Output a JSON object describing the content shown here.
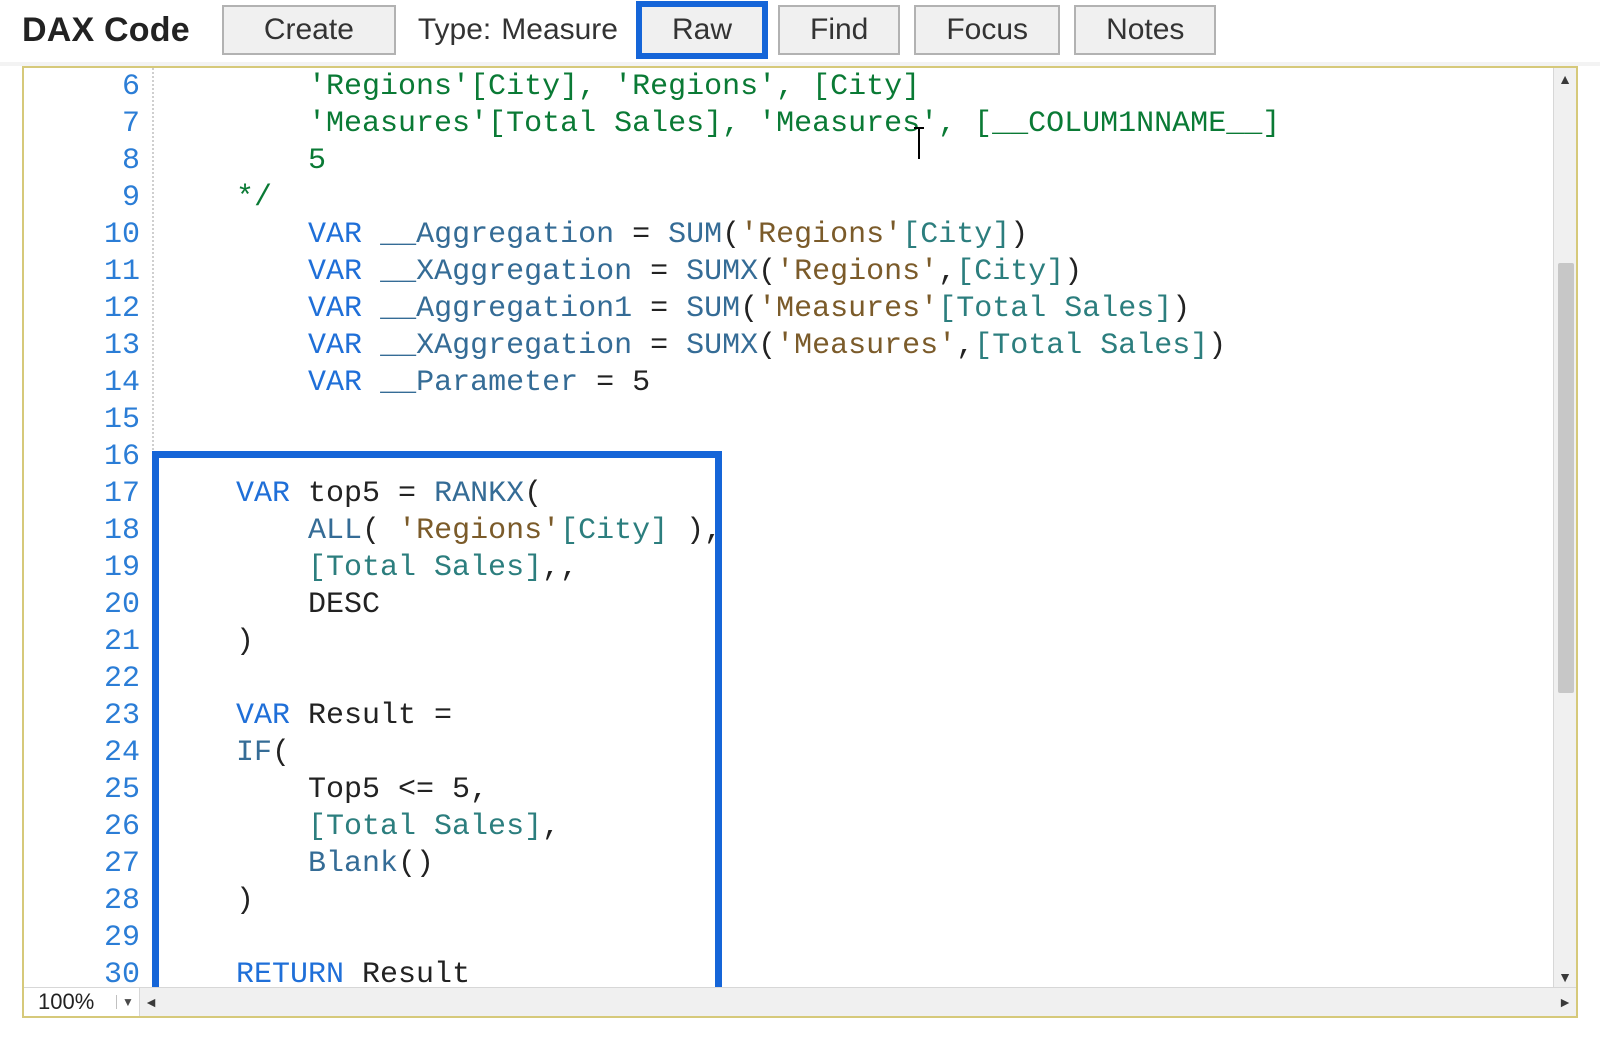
{
  "toolbar": {
    "title": "DAX Code",
    "create_label": "Create",
    "type_label": "Type:",
    "type_value": "Measure",
    "raw_label": "Raw",
    "find_label": "Find",
    "focus_label": "Focus",
    "notes_label": "Notes"
  },
  "editor": {
    "zoom": "100%",
    "first_visible_line": 6,
    "lines": [
      {
        "n": 6,
        "indent": 8,
        "tokens": [
          {
            "t": "cmt",
            "v": "'Regions'[City], 'Regions', [City]"
          }
        ]
      },
      {
        "n": 7,
        "indent": 8,
        "cursor_after_char": 34,
        "tokens": [
          {
            "t": "cmt",
            "v": "'Measures'[Total Sales], 'Measures', [__COLUM1NNAME__]"
          }
        ]
      },
      {
        "n": 8,
        "indent": 8,
        "tokens": [
          {
            "t": "cmt",
            "v": "5"
          }
        ]
      },
      {
        "n": 9,
        "indent": 4,
        "tokens": [
          {
            "t": "cmt",
            "v": "*/"
          }
        ]
      },
      {
        "n": 10,
        "indent": 8,
        "tokens": [
          {
            "t": "kw",
            "v": "VAR"
          },
          {
            "t": "plain",
            "v": " "
          },
          {
            "t": "var",
            "v": "__Aggregation"
          },
          {
            "t": "plain",
            "v": " = "
          },
          {
            "t": "fn",
            "v": "SUM"
          },
          {
            "t": "plain",
            "v": "("
          },
          {
            "t": "str",
            "v": "'Regions'"
          },
          {
            "t": "col",
            "v": "[City]"
          },
          {
            "t": "plain",
            "v": ")"
          }
        ]
      },
      {
        "n": 11,
        "indent": 8,
        "tokens": [
          {
            "t": "kw",
            "v": "VAR"
          },
          {
            "t": "plain",
            "v": " "
          },
          {
            "t": "var",
            "v": "__XAggregation"
          },
          {
            "t": "plain",
            "v": " = "
          },
          {
            "t": "fn",
            "v": "SUMX"
          },
          {
            "t": "plain",
            "v": "("
          },
          {
            "t": "str",
            "v": "'Regions'"
          },
          {
            "t": "plain",
            "v": ","
          },
          {
            "t": "col",
            "v": "[City]"
          },
          {
            "t": "plain",
            "v": ")"
          }
        ]
      },
      {
        "n": 12,
        "indent": 8,
        "tokens": [
          {
            "t": "kw",
            "v": "VAR"
          },
          {
            "t": "plain",
            "v": " "
          },
          {
            "t": "var",
            "v": "__Aggregation1"
          },
          {
            "t": "plain",
            "v": " = "
          },
          {
            "t": "fn",
            "v": "SUM"
          },
          {
            "t": "plain",
            "v": "("
          },
          {
            "t": "str",
            "v": "'Measures'"
          },
          {
            "t": "col",
            "v": "[Total Sales]"
          },
          {
            "t": "plain",
            "v": ")"
          }
        ]
      },
      {
        "n": 13,
        "indent": 8,
        "tokens": [
          {
            "t": "kw",
            "v": "VAR"
          },
          {
            "t": "plain",
            "v": " "
          },
          {
            "t": "var",
            "v": "__XAggregation"
          },
          {
            "t": "plain",
            "v": " = "
          },
          {
            "t": "fn",
            "v": "SUMX"
          },
          {
            "t": "plain",
            "v": "("
          },
          {
            "t": "str",
            "v": "'Measures'"
          },
          {
            "t": "plain",
            "v": ","
          },
          {
            "t": "col",
            "v": "[Total Sales]"
          },
          {
            "t": "plain",
            "v": ")"
          }
        ]
      },
      {
        "n": 14,
        "indent": 8,
        "tokens": [
          {
            "t": "kw",
            "v": "VAR"
          },
          {
            "t": "plain",
            "v": " "
          },
          {
            "t": "var",
            "v": "__Parameter"
          },
          {
            "t": "plain",
            "v": " = "
          },
          {
            "t": "num",
            "v": "5"
          }
        ]
      },
      {
        "n": 15,
        "indent": 0,
        "tokens": []
      },
      {
        "n": 16,
        "indent": 0,
        "tokens": []
      },
      {
        "n": 17,
        "indent": 4,
        "tokens": [
          {
            "t": "kw",
            "v": "VAR"
          },
          {
            "t": "plain",
            "v": " top5 = "
          },
          {
            "t": "fn",
            "v": "RANKX"
          },
          {
            "t": "plain",
            "v": "("
          }
        ]
      },
      {
        "n": 18,
        "indent": 8,
        "tokens": [
          {
            "t": "fn",
            "v": "ALL"
          },
          {
            "t": "plain",
            "v": "( "
          },
          {
            "t": "str",
            "v": "'Regions'"
          },
          {
            "t": "col",
            "v": "[City]"
          },
          {
            "t": "plain",
            "v": " ),"
          }
        ]
      },
      {
        "n": 19,
        "indent": 8,
        "tokens": [
          {
            "t": "col",
            "v": "[Total Sales]"
          },
          {
            "t": "plain",
            "v": ",,"
          }
        ]
      },
      {
        "n": 20,
        "indent": 8,
        "tokens": [
          {
            "t": "plain",
            "v": "DESC"
          }
        ]
      },
      {
        "n": 21,
        "indent": 4,
        "tokens": [
          {
            "t": "plain",
            "v": ")"
          }
        ]
      },
      {
        "n": 22,
        "indent": 0,
        "tokens": []
      },
      {
        "n": 23,
        "indent": 4,
        "tokens": [
          {
            "t": "kw",
            "v": "VAR"
          },
          {
            "t": "plain",
            "v": " Result ="
          }
        ]
      },
      {
        "n": 24,
        "indent": 4,
        "tokens": [
          {
            "t": "fn",
            "v": "IF"
          },
          {
            "t": "plain",
            "v": "("
          }
        ]
      },
      {
        "n": 25,
        "indent": 8,
        "tokens": [
          {
            "t": "plain",
            "v": "Top5 <= "
          },
          {
            "t": "num",
            "v": "5"
          },
          {
            "t": "plain",
            "v": ","
          }
        ]
      },
      {
        "n": 26,
        "indent": 8,
        "tokens": [
          {
            "t": "col",
            "v": "[Total Sales]"
          },
          {
            "t": "plain",
            "v": ","
          }
        ]
      },
      {
        "n": 27,
        "indent": 8,
        "tokens": [
          {
            "t": "fn",
            "v": "Blank"
          },
          {
            "t": "plain",
            "v": "()"
          }
        ]
      },
      {
        "n": 28,
        "indent": 4,
        "tokens": [
          {
            "t": "plain",
            "v": ")"
          }
        ]
      },
      {
        "n": 29,
        "indent": 0,
        "tokens": []
      },
      {
        "n": 30,
        "indent": 4,
        "tokens": [
          {
            "t": "kw",
            "v": "RETURN"
          },
          {
            "t": "plain",
            "v": " Result"
          }
        ]
      }
    ]
  }
}
